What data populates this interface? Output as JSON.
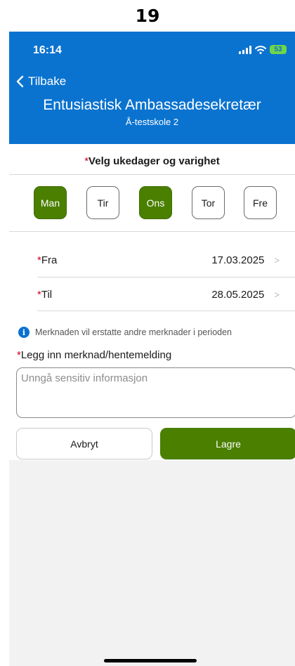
{
  "page_number": "19",
  "status_bar": {
    "time": "16:14",
    "battery": "53"
  },
  "header": {
    "back_label": "Tilbake",
    "title": "Entusiastisk Ambassadesekretær",
    "subtitle": "Å-testskole 2"
  },
  "days_section": {
    "required_mark": "*",
    "title": "Velg ukedager og varighet",
    "days": [
      {
        "label": "Man",
        "selected": true
      },
      {
        "label": "Tir",
        "selected": false
      },
      {
        "label": "Ons",
        "selected": true
      },
      {
        "label": "Tor",
        "selected": false
      },
      {
        "label": "Fre",
        "selected": false
      }
    ]
  },
  "dates": {
    "from": {
      "required_mark": "*",
      "label": "Fra",
      "value": "17.03.2025"
    },
    "to": {
      "required_mark": "*",
      "label": "Til",
      "value": "28.05.2025"
    }
  },
  "info_text": "Merknaden vil erstatte andre merknader i perioden",
  "note": {
    "required_mark": "*",
    "label": "Legg inn merknad/hentemelding",
    "placeholder": "Unngå sensitiv informasjon"
  },
  "buttons": {
    "cancel": "Avbryt",
    "save": "Lagre"
  },
  "colors": {
    "header_blue": "#0a73cf",
    "selected_green": "#4a7f00",
    "required_red": "#d0021b"
  }
}
